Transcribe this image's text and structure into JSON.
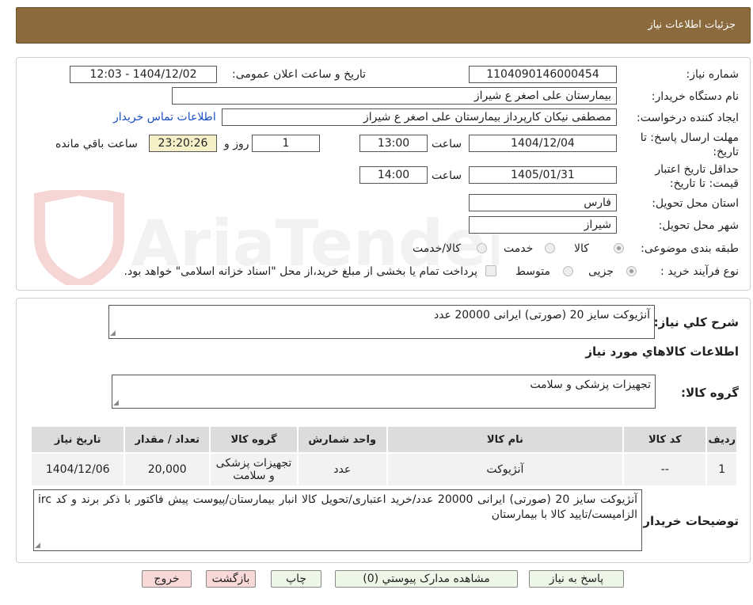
{
  "header": {
    "title": "جزئیات اطلاعات نیاز"
  },
  "watermark": {
    "text": "AriaTender.net"
  },
  "form": {
    "need_number_label": "شماره نیاز:",
    "need_number": "1104090146000454",
    "announce_label": "تاریخ و ساعت اعلان عمومی:",
    "announce_value": "1404/12/02 - 12:03",
    "buyer_org_label": "نام دستگاه خریدار:",
    "buyer_org": "بیمارستان علی اصغر  ع  شیراز",
    "requester_label": "ایجاد کننده درخواست:",
    "requester": "مصطفی نیکان کارپرداز بیمارستان علی اصغر  ع  شیراز",
    "contact_link": "اطلاعات تماس خریدار",
    "deadline_label": "مهلت ارسال پاسخ: تا تاریخ:",
    "deadline_date": "1404/12/04",
    "time_label": "ساعت",
    "deadline_time": "13:00",
    "days_value": "1",
    "days_label": "روز و",
    "remaining_time": "23:20:26",
    "remaining_label": "ساعت باقي مانده",
    "validity_label": "حداقل تاریخ اعتبار قیمت: تا تاریخ:",
    "validity_date": "1405/01/31",
    "validity_time": "14:00",
    "province_label": "استان محل تحویل:",
    "province": "فارس",
    "city_label": "شهر محل تحویل:",
    "city": "شیراز",
    "category_label": "طبقه بندی موضوعی:",
    "category_options": [
      "کالا",
      "خدمت",
      "کالا/خدمت"
    ],
    "purchase_label": "نوع فرآیند خرید :",
    "purchase_options": [
      "جزیی",
      "متوسط"
    ],
    "payment_note": "پرداخت تمام یا بخشی از مبلغ خرید،از محل \"اسناد خزانه اسلامی\" خواهد بود."
  },
  "summary": {
    "general_desc_label": "شرح کلي نیاز:",
    "general_desc": "آنژیوکت سایز 20 (صورتی) ایرانی      20000 عدد",
    "goods_info_title": "اطلاعات کالاهاي مورد نیاز",
    "goods_group_label": "گروه کالا:",
    "goods_group": "تجهیزات پزشکی و سلامت",
    "table": {
      "headers": [
        "ردیف",
        "کد کالا",
        "نام کالا",
        "واحد شمارش",
        "گروه کالا",
        "تعداد / مقدار",
        "تاریخ نیاز"
      ],
      "rows": [
        [
          "1",
          "--",
          "آنژیوکت",
          "عدد",
          "تجهیزات پزشکی و سلامت",
          "20,000",
          "1404/12/06"
        ]
      ]
    },
    "buyer_notes_label": "توضیحات خریدار:",
    "buyer_notes": "آنژیوکت سایز 20 (صورتی) ایرانی 20000 عدد/خرید اعتباری/تحویل کالا انبار بیمارستان/پیوست پیش فاکتور با ذکر برند و کد irc الزامیست/تایید کالا با بیمارستان"
  },
  "buttons": {
    "reply": "پاسخ به نیاز",
    "attachments": "مشاهده مدارک پیوستي (0)",
    "print": "چاپ",
    "back": "بازگشت",
    "exit": "خروج"
  }
}
